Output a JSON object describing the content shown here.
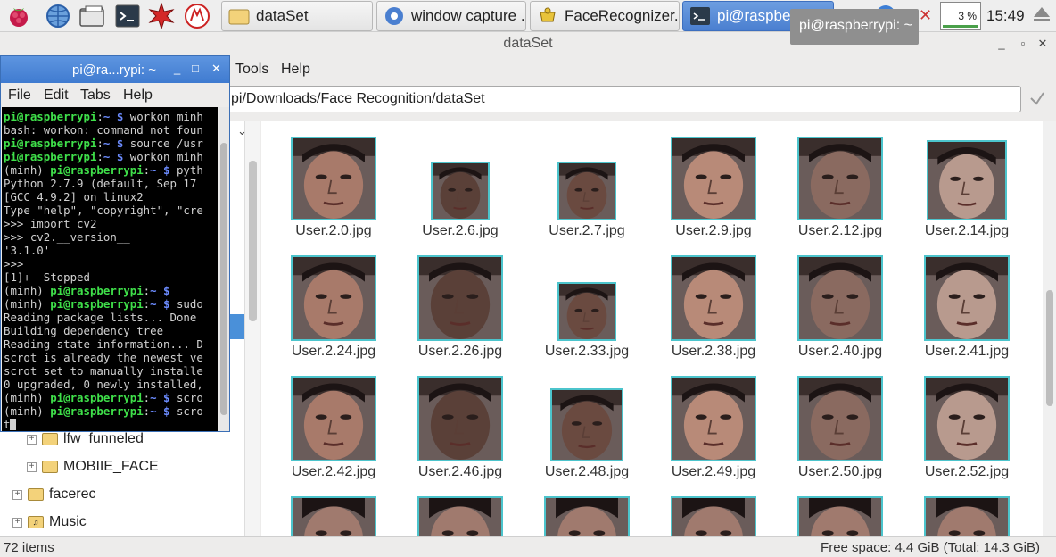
{
  "taskbar": {
    "tasks": [
      {
        "label": "dataSet"
      },
      {
        "label": "window capture ..."
      },
      {
        "label": "FaceRecognizer..."
      },
      {
        "label": "pi@raspberr"
      }
    ],
    "tooltip": "pi@raspberrypi: ~",
    "cpu_label": "3 %",
    "clock": "15:49",
    "icons": [
      "raspberry-menu-icon",
      "web-browser-icon",
      "file-manager-icon",
      "terminal-icon",
      "mathematica-icon",
      "wolfram-icon"
    ]
  },
  "file_manager": {
    "title": "dataSet",
    "menu": {
      "tools": "Tools",
      "help": "Help"
    },
    "path": "pi/Downloads/Face Recognition/dataSet",
    "tree": [
      {
        "label": "lfw_funneled",
        "icon": "folder-icon"
      },
      {
        "label": "MOBIIE_FACE",
        "icon": "folder-icon"
      },
      {
        "label": "facerec",
        "icon": "folder-icon"
      },
      {
        "label": "Music",
        "icon": "music-folder-icon"
      }
    ],
    "files": [
      "User.2.0.jpg",
      "User.2.6.jpg",
      "User.2.7.jpg",
      "User.2.9.jpg",
      "User.2.12.jpg",
      "User.2.14.jpg",
      "User.2.24.jpg",
      "User.2.26.jpg",
      "User.2.33.jpg",
      "User.2.38.jpg",
      "User.2.40.jpg",
      "User.2.41.jpg",
      "User.2.42.jpg",
      "User.2.46.jpg",
      "User.2.48.jpg",
      "User.2.49.jpg",
      "User.2.50.jpg",
      "User.2.52.jpg"
    ],
    "status_left": "72 items",
    "status_right": "Free space: 4.4 GiB (Total: 14.3 GiB)"
  },
  "terminal": {
    "title": "pi@ra...rypi: ~",
    "menu": {
      "file": "File",
      "edit": "Edit",
      "tabs": "Tabs",
      "help": "Help"
    },
    "lines": [
      [
        {
          "t": "pi@raspberrypi",
          "c": "g"
        },
        {
          "t": ":",
          "c": ""
        },
        {
          "t": "~ $",
          "c": "b"
        },
        {
          "t": " workon minh",
          "c": ""
        }
      ],
      [
        {
          "t": "bash: workon: command not foun",
          "c": ""
        }
      ],
      [
        {
          "t": "pi@raspberrypi",
          "c": "g"
        },
        {
          "t": ":",
          "c": ""
        },
        {
          "t": "~ $",
          "c": "b"
        },
        {
          "t": " source /usr",
          "c": ""
        }
      ],
      [
        {
          "t": "pi@raspberrypi",
          "c": "g"
        },
        {
          "t": ":",
          "c": ""
        },
        {
          "t": "~ $",
          "c": "b"
        },
        {
          "t": " workon minh",
          "c": ""
        }
      ],
      [
        {
          "t": "(minh) ",
          "c": ""
        },
        {
          "t": "pi@raspberrypi",
          "c": "g"
        },
        {
          "t": ":",
          "c": ""
        },
        {
          "t": "~ $",
          "c": "b"
        },
        {
          "t": " pyth",
          "c": ""
        }
      ],
      [
        {
          "t": "Python 2.7.9 (default, Sep 17",
          "c": ""
        }
      ],
      [
        {
          "t": "[GCC 4.9.2] on linux2",
          "c": ""
        }
      ],
      [
        {
          "t": "Type \"help\", \"copyright\", \"cre",
          "c": ""
        }
      ],
      [
        {
          "t": ">>> import cv2",
          "c": ""
        }
      ],
      [
        {
          "t": ">>> cv2.__version__",
          "c": ""
        }
      ],
      [
        {
          "t": "'3.1.0'",
          "c": ""
        }
      ],
      [
        {
          "t": ">>>",
          "c": ""
        }
      ],
      [
        {
          "t": "[1]+  Stopped",
          "c": ""
        }
      ],
      [
        {
          "t": "(minh) ",
          "c": ""
        },
        {
          "t": "pi@raspberrypi",
          "c": "g"
        },
        {
          "t": ":",
          "c": ""
        },
        {
          "t": "~ $",
          "c": "b"
        }
      ],
      [
        {
          "t": "(minh) ",
          "c": ""
        },
        {
          "t": "pi@raspberrypi",
          "c": "g"
        },
        {
          "t": ":",
          "c": ""
        },
        {
          "t": "~ $",
          "c": "b"
        },
        {
          "t": " sudo",
          "c": ""
        }
      ],
      [
        {
          "t": "Reading package lists... Done",
          "c": ""
        }
      ],
      [
        {
          "t": "Building dependency tree",
          "c": ""
        }
      ],
      [
        {
          "t": "Reading state information... D",
          "c": ""
        }
      ],
      [
        {
          "t": "scrot is already the newest ve",
          "c": ""
        }
      ],
      [
        {
          "t": "scrot set to manually installe",
          "c": ""
        }
      ],
      [
        {
          "t": "0 upgraded, 0 newly installed,",
          "c": ""
        }
      ],
      [
        {
          "t": "(minh) ",
          "c": ""
        },
        {
          "t": "pi@raspberrypi",
          "c": "g"
        },
        {
          "t": ":",
          "c": ""
        },
        {
          "t": "~ $",
          "c": "b"
        },
        {
          "t": " scro",
          "c": ""
        }
      ],
      [
        {
          "t": "(minh) ",
          "c": ""
        },
        {
          "t": "pi@raspberrypi",
          "c": "g"
        },
        {
          "t": ":",
          "c": ""
        },
        {
          "t": "~ $",
          "c": "b"
        },
        {
          "t": " scro",
          "c": ""
        }
      ],
      [
        {
          "t": "t",
          "c": ""
        }
      ]
    ]
  }
}
